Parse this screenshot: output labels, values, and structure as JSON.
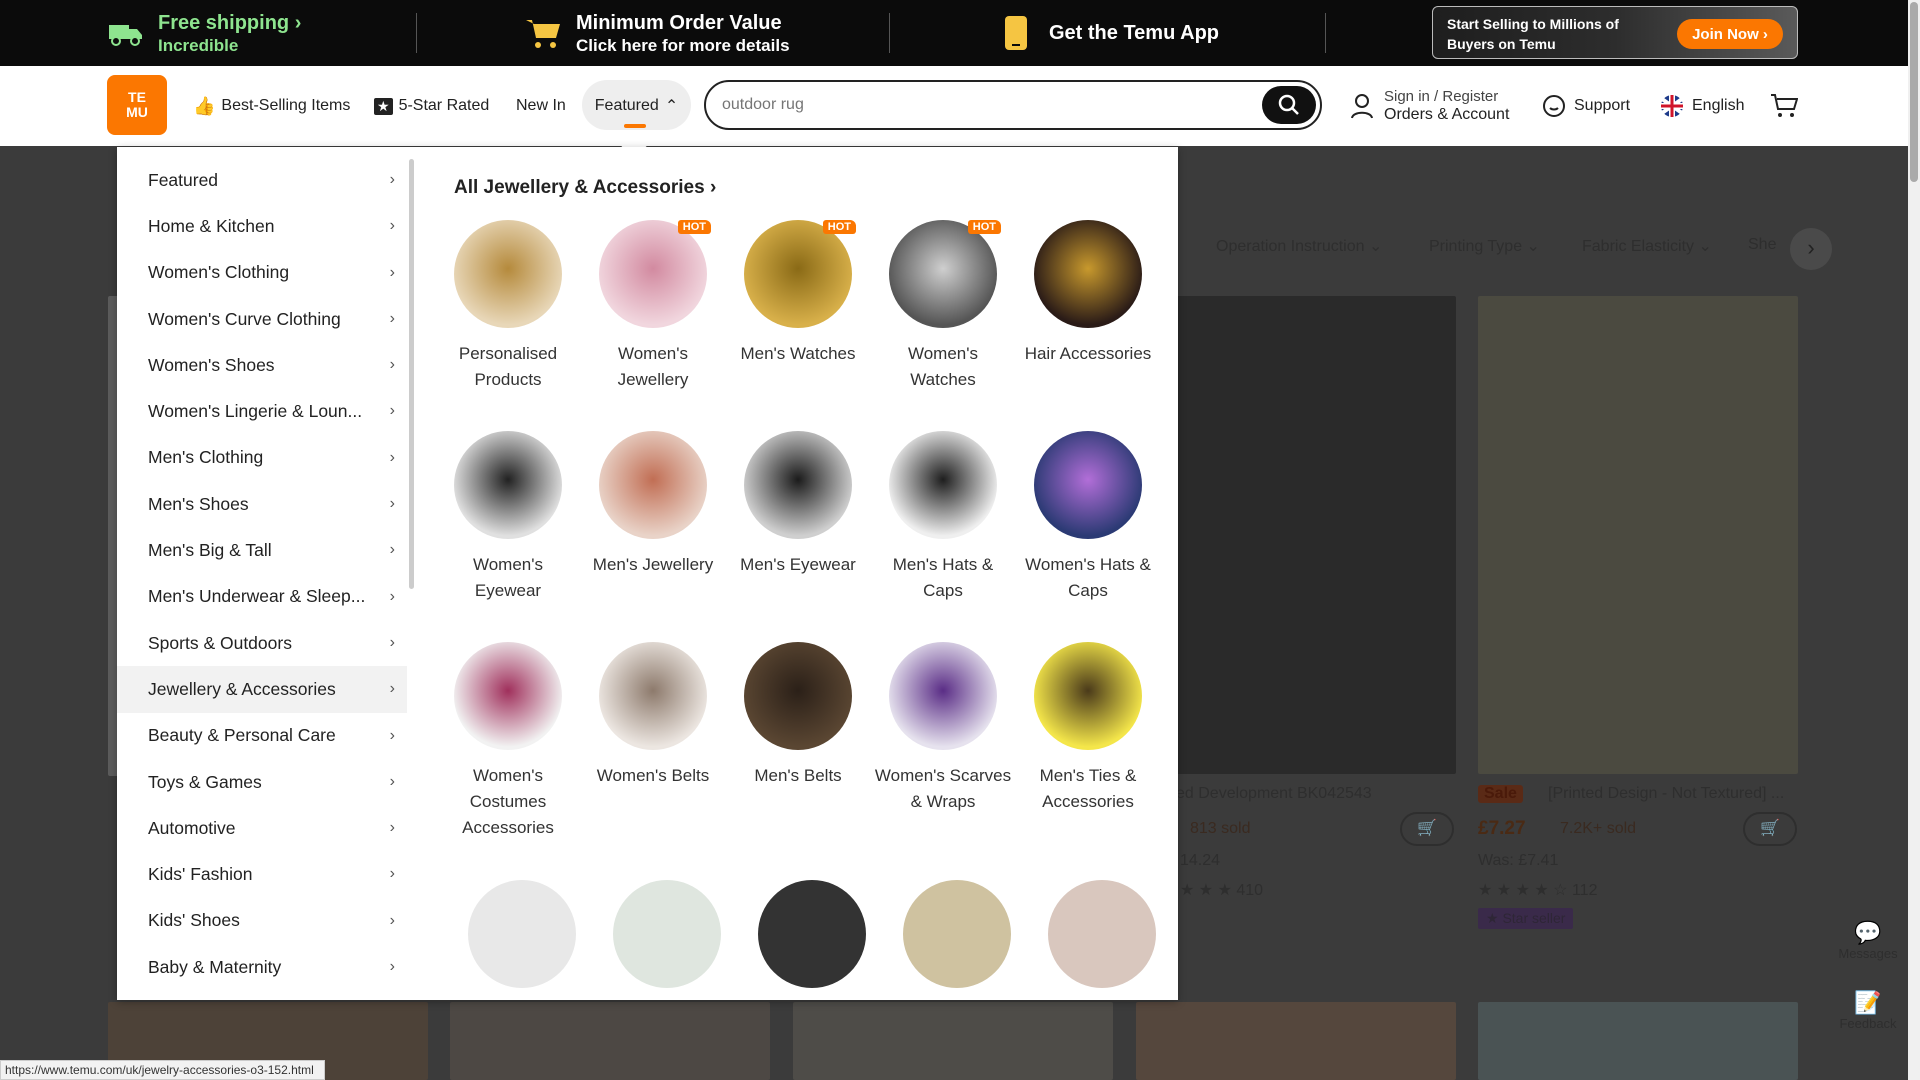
{
  "topbar": {
    "shipping_title": "Free shipping",
    "shipping_sub": "Incredible",
    "min_order_title": "Minimum Order Value",
    "min_order_sub": "Click here for more details",
    "app_label": "Get the Temu App",
    "promo_text_1": "Start Selling to Millions of",
    "promo_text_2": "Buyers on Temu",
    "join_label": "Join Now"
  },
  "header": {
    "logo_text_1": "TE",
    "logo_text_2": "MU",
    "nav_best": "Best-Selling Items",
    "nav_five_star": "5-Star Rated",
    "nav_new": "New In",
    "nav_featured": "Featured",
    "search_placeholder": "outdoor rug",
    "sign_in": "Sign in / Register",
    "orders": "Orders & Account",
    "support": "Support",
    "language": "English"
  },
  "menu": {
    "categories": [
      "Featured",
      "Home & Kitchen",
      "Women's Clothing",
      "Women's Curve Clothing",
      "Women's Shoes",
      "Women's Lingerie & Loun...",
      "Men's Clothing",
      "Men's Shoes",
      "Men's Big & Tall",
      "Men's Underwear & Sleep...",
      "Sports & Outdoors",
      "Jewellery & Accessories",
      "Beauty & Personal Care",
      "Toys & Games",
      "Automotive",
      "Kids' Fashion",
      "Kids' Shoes",
      "Baby & Maternity"
    ],
    "active_index": 11,
    "panel_title": "All Jewellery & Accessories",
    "subcategories": [
      {
        "label": "Personalised Products",
        "hot": false
      },
      {
        "label": "Women's Jewellery",
        "hot": true
      },
      {
        "label": "Men's Watches",
        "hot": true
      },
      {
        "label": "Women's Watches",
        "hot": true
      },
      {
        "label": "Hair Accessories",
        "hot": false
      },
      {
        "label": "Women's Eyewear",
        "hot": false
      },
      {
        "label": "Men's Jewellery",
        "hot": false
      },
      {
        "label": "Men's Eyewear",
        "hot": false
      },
      {
        "label": "Men's Hats & Caps",
        "hot": false
      },
      {
        "label": "Women's Hats & Caps",
        "hot": false
      },
      {
        "label": "Women's Costumes Accessories",
        "hot": false
      },
      {
        "label": "Women's Belts",
        "hot": false
      },
      {
        "label": "Men's Belts",
        "hot": false
      },
      {
        "label": "Women's Scarves & Wraps",
        "hot": false
      },
      {
        "label": "Men's Ties & Accessories",
        "hot": false
      }
    ],
    "hot_label": "HOT"
  },
  "background": {
    "filters": [
      "Operation Instruction",
      "Printing Type",
      "Fabric Elasticity",
      "She"
    ],
    "product_a_title": "ed Development BK042543",
    "product_a_sold": "813 sold",
    "product_a_was": "14.24",
    "product_a_reviews": "410",
    "product_b_sale": "Sale",
    "product_b_title": "[Printed Design - Not Textured] ...",
    "product_b_price": "£7.27",
    "product_b_sold": "7.2K+ sold",
    "product_b_was": "Was: £7.41",
    "product_b_reviews": "112",
    "product_b_badge": "Star seller"
  },
  "side_tools": {
    "messages": "Messages",
    "feedback": "Feedback"
  },
  "status_url": "https://www.temu.com/uk/jewelry-accessories-o3-152.html",
  "colors": {
    "brand": "#fb7701",
    "shipping_green": "#8ee48f",
    "topbar_bg": "#0b0b0b"
  }
}
